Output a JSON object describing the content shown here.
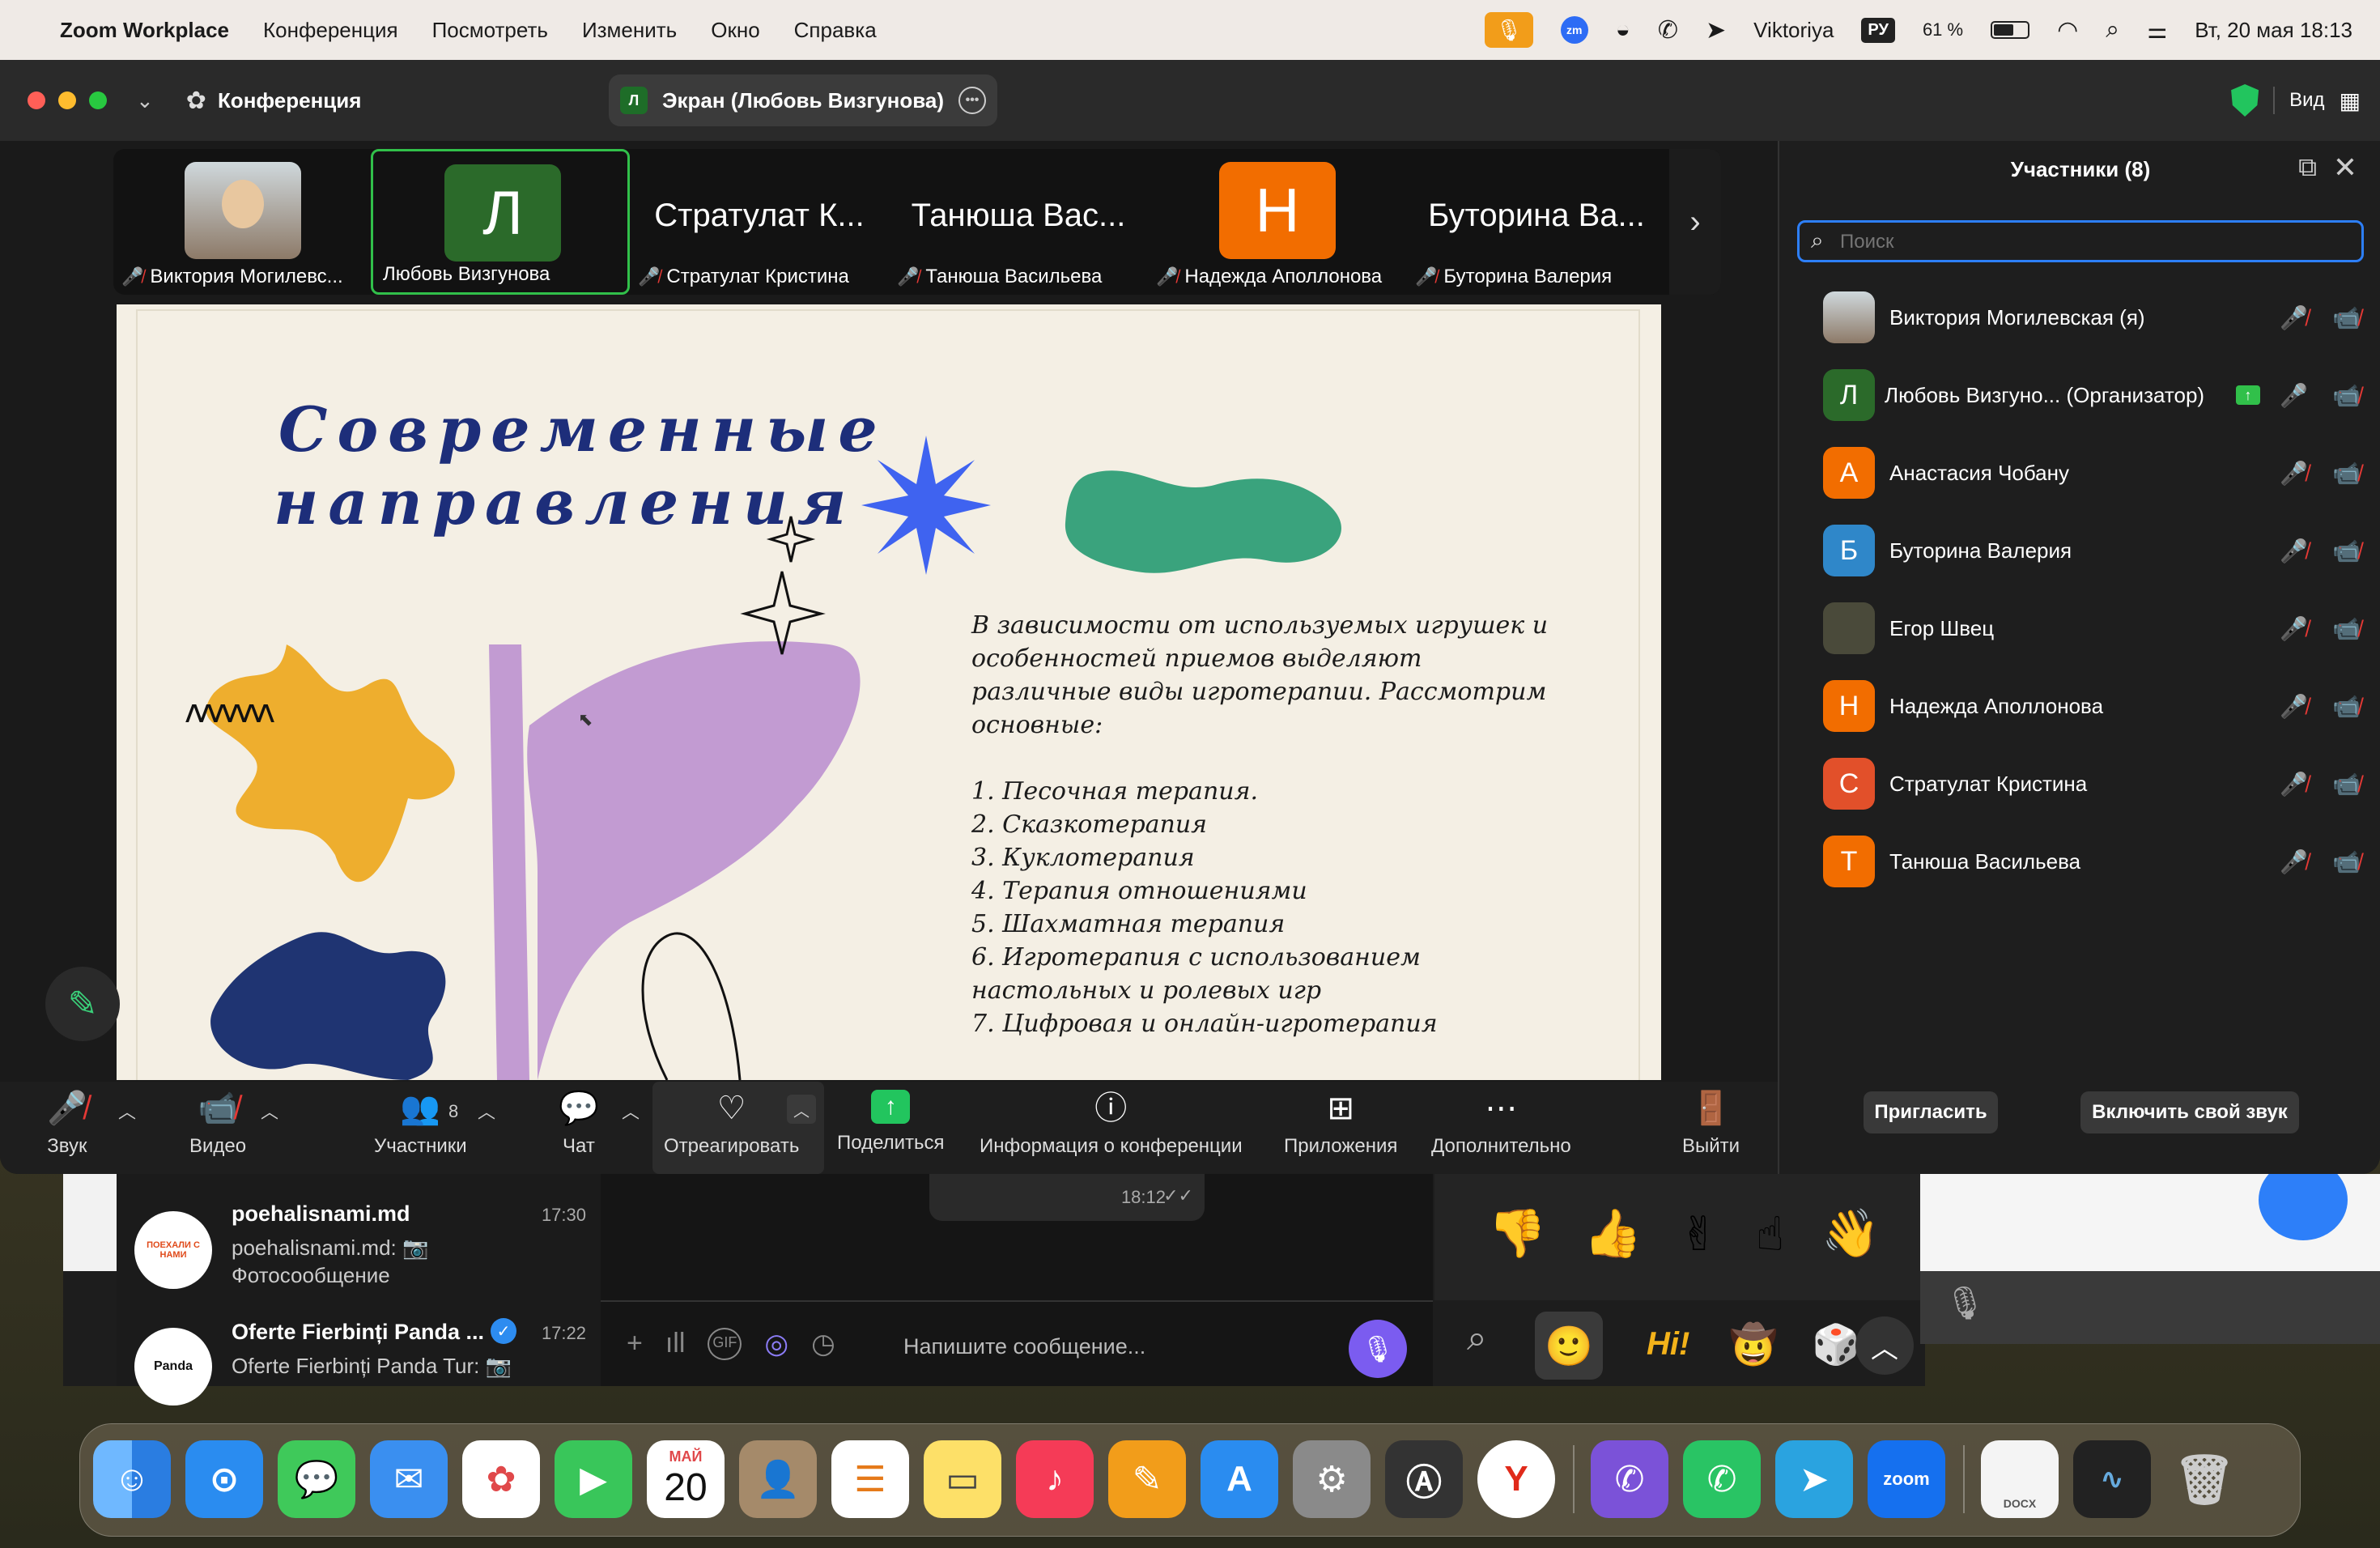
{
  "menubar": {
    "app_name": "Zoom Workplace",
    "menus": [
      "Конференция",
      "Посмотреть",
      "Изменить",
      "Окно",
      "Справка"
    ],
    "user": "Viktoriya",
    "input_lang": "РУ",
    "battery": "61 %",
    "battery_level": 0.61,
    "datetime": "Вт, 20 мая  18:13",
    "zoom_badge": "zm"
  },
  "window": {
    "title": "Конференция",
    "screen_share_label": "Экран (Любовь Визгунова)",
    "screen_share_avatar": "Л",
    "view_label": "Вид"
  },
  "strip": {
    "tiles": [
      {
        "label": "Виктория Могилевс...",
        "big": "",
        "avatar": "",
        "color": ""
      },
      {
        "label": "Любовь Визгунова",
        "big": "",
        "avatar": "Л",
        "color": "#2b6a2a"
      },
      {
        "label": "Стратулат Кристина",
        "big": "Стратулат К...",
        "avatar": "",
        "color": ""
      },
      {
        "label": "Танюша Васильева",
        "big": "Танюша Вас...",
        "avatar": "",
        "color": ""
      },
      {
        "label": "Надежда Аполлонова",
        "big": "",
        "avatar": "Н",
        "color": "#f26d00"
      },
      {
        "label": "Буторина Валерия",
        "big": "Буторина Ва...",
        "avatar": "",
        "color": ""
      }
    ]
  },
  "slide": {
    "title_line1": "Современные",
    "title_line2": "направления",
    "intro": [
      "В зависимости от используемых игрушек и",
      "особенностей приемов выделяют",
      "различные виды игротерапии. Рассмотрим",
      "основные:"
    ],
    "items": [
      "1. Песочная терапия.",
      "2. Сказкотерапия",
      "3. Куклотерапия",
      "4. Терапия отношениями",
      "5. Шахматная терапия",
      "6. Игротерапия с использованием",
      "настольных и ролевых игр",
      "7. Цифровая и онлайн-игротерапия"
    ],
    "doodle": "ʌʌʌʌʌʌ"
  },
  "panel": {
    "title": "Участники (8)",
    "search_placeholder": "Поиск",
    "participants": [
      {
        "name": "Виктория Могилевская (я)",
        "avatar": "",
        "color": "#8a7a6a"
      },
      {
        "name": "Любовь Визгуно... (Организатор)",
        "avatar": "Л",
        "color": "#2b6a2a"
      },
      {
        "name": "Анастасия Чобану",
        "avatar": "А",
        "color": "#f26d00"
      },
      {
        "name": "Буторина Валерия",
        "avatar": "Б",
        "color": "#2f87c9"
      },
      {
        "name": "Егор Швец",
        "avatar": "",
        "color": "#4a4a3a"
      },
      {
        "name": "Надежда Аполлонова",
        "avatar": "Н",
        "color": "#f26d00"
      },
      {
        "name": "Стратулат Кристина",
        "avatar": "С",
        "color": "#e2502a"
      },
      {
        "name": "Танюша Васильева",
        "avatar": "Т",
        "color": "#f26d00"
      }
    ],
    "invite_label": "Пригласить",
    "unmute_label": "Включить свой звук"
  },
  "toolbar": {
    "audio": "Звук",
    "video": "Видео",
    "participants": "Участники",
    "participants_count": "8",
    "chat": "Чат",
    "react": "Отреагировать",
    "share": "Поделиться",
    "info": "Информация о конференции",
    "apps": "Приложения",
    "more": "Дополнительно",
    "leave": "Выйти"
  },
  "chatapp": {
    "chats": [
      {
        "title": "poehalisnami.md",
        "time": "17:30",
        "line1": "poehalisnami.md: 📷",
        "line2": "Фотосообщение",
        "logo": "ПОЕХАЛИ С НАМИ"
      },
      {
        "title": "Oferte Fierbinți Panda ...",
        "time": "17:22",
        "line1": "Oferte Fierbinți Panda Tur: 📷",
        "line2": "",
        "logo": "Panda"
      }
    ],
    "bubble_time": "18:12",
    "composer_placeholder": "Напишите сообщение...",
    "sticker_hi": "Hi!"
  },
  "dock": {
    "calendar_month": "МАЙ",
    "calendar_day": "20",
    "zoom_label": "zoom",
    "docx_label": "DOCX"
  }
}
